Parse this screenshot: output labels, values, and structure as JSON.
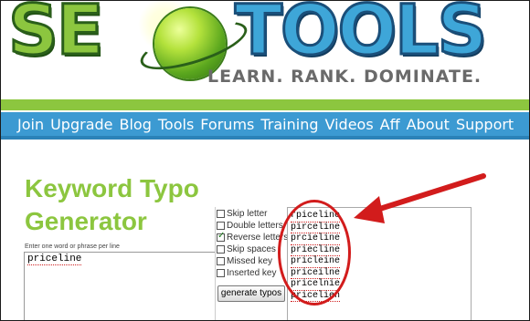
{
  "header": {
    "logo_left": "SE",
    "logo_right": "TOOLS",
    "tagline": "LEARN. RANK. DOMINATE."
  },
  "nav": {
    "items": [
      "Join",
      "Upgrade",
      "Blog",
      "Tools",
      "Forums",
      "Training",
      "Videos",
      "Aff",
      "About",
      "Support"
    ]
  },
  "page": {
    "title": "Keyword Typo Generator",
    "input_hint": "Enter one word or phrase per line",
    "input_value": "priceline"
  },
  "options": [
    {
      "label": "Skip letter",
      "checked": false
    },
    {
      "label": "Double letters",
      "checked": false
    },
    {
      "label": "Reverse letters",
      "checked": true
    },
    {
      "label": "Skip spaces",
      "checked": false
    },
    {
      "label": "Missed key",
      "checked": false
    },
    {
      "label": "Inserted key",
      "checked": false
    }
  ],
  "generate_button": "generate typos",
  "output": [
    "rpiceline",
    "pirceline",
    "prcieline",
    "priecline",
    "pricleine",
    "priceilne",
    "pricelnie",
    "pricelien"
  ],
  "colors": {
    "brand_green": "#8cc63f",
    "brand_blue": "#3c9ad2",
    "annotation_red": "#d21c1c"
  }
}
